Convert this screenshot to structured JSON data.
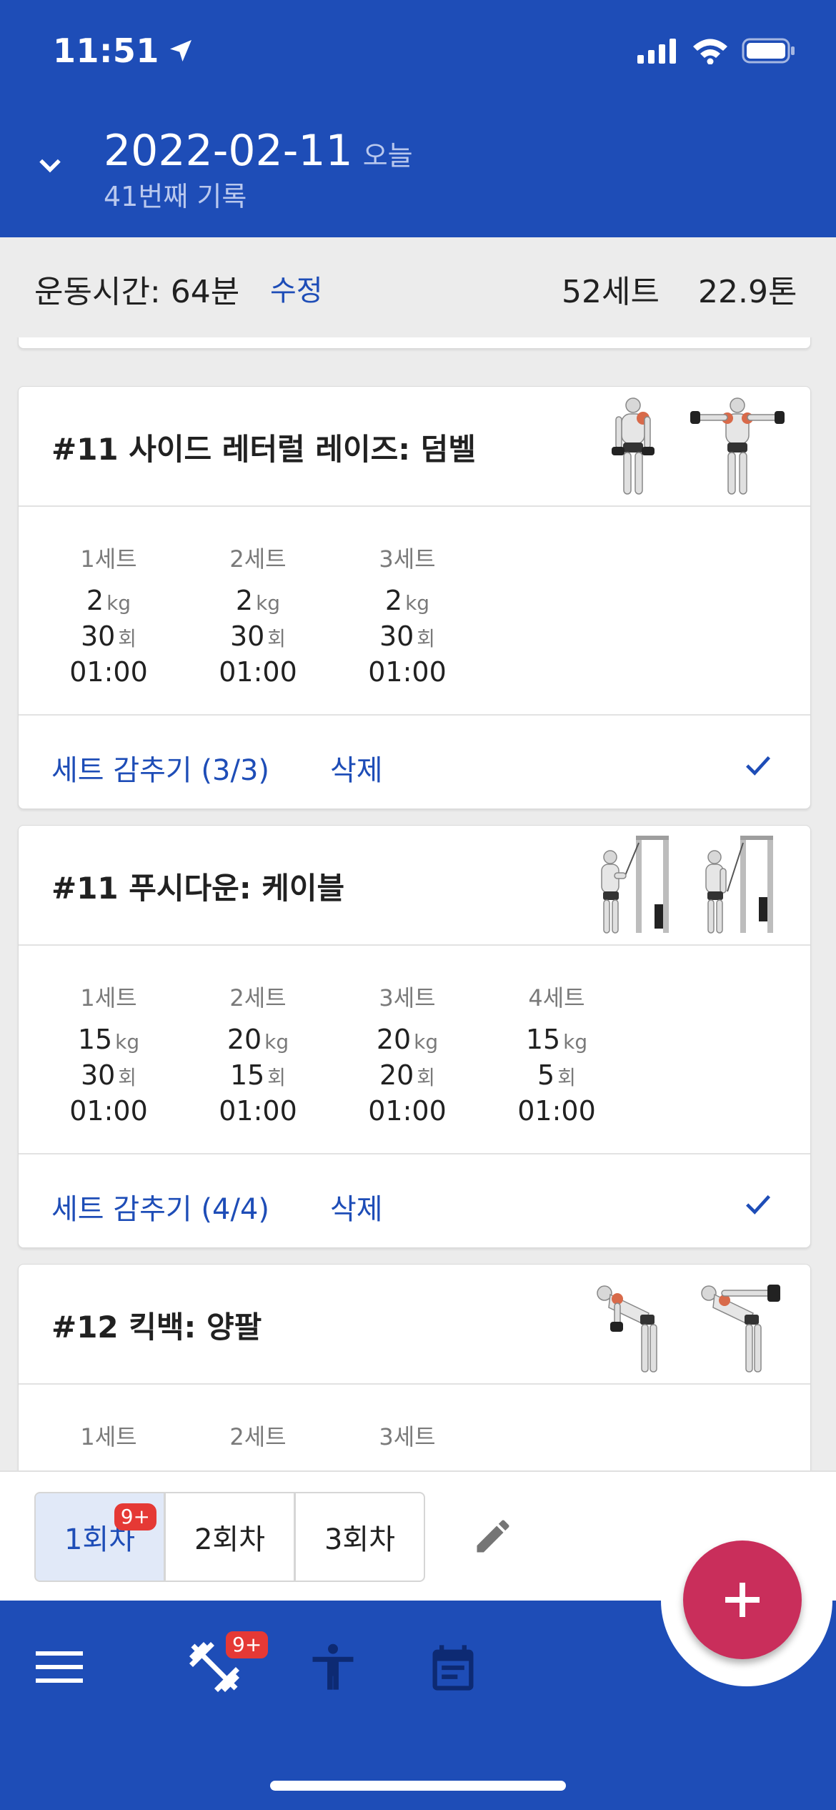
{
  "status": {
    "time": "11:51"
  },
  "header": {
    "date": "2022-02-11",
    "today_label": "오늘",
    "record_count": "41번째 기록"
  },
  "summary": {
    "duration": "운동시간: 64분",
    "edit_label": "수정",
    "sets_total": "52세트",
    "volume_total": "22.9톤"
  },
  "exercises": [
    {
      "title": "#11 사이드 레터럴 레이즈: 덤벨",
      "sets": [
        {
          "name": "1세트",
          "weight": "2",
          "weight_unit": "kg",
          "reps": "30",
          "reps_unit": "회",
          "time": "01:00"
        },
        {
          "name": "2세트",
          "weight": "2",
          "weight_unit": "kg",
          "reps": "30",
          "reps_unit": "회",
          "time": "01:00"
        },
        {
          "name": "3세트",
          "weight": "2",
          "weight_unit": "kg",
          "reps": "30",
          "reps_unit": "회",
          "time": "01:00"
        }
      ],
      "hide_label": "세트 감추기 (3/3)",
      "delete_label": "삭제"
    },
    {
      "title": "#11 푸시다운: 케이블",
      "sets": [
        {
          "name": "1세트",
          "weight": "15",
          "weight_unit": "kg",
          "reps": "30",
          "reps_unit": "회",
          "time": "01:00"
        },
        {
          "name": "2세트",
          "weight": "20",
          "weight_unit": "kg",
          "reps": "15",
          "reps_unit": "회",
          "time": "01:00"
        },
        {
          "name": "3세트",
          "weight": "20",
          "weight_unit": "kg",
          "reps": "20",
          "reps_unit": "회",
          "time": "01:00"
        },
        {
          "name": "4세트",
          "weight": "15",
          "weight_unit": "kg",
          "reps": "5",
          "reps_unit": "회",
          "time": "01:00"
        }
      ],
      "hide_label": "세트 감추기 (4/4)",
      "delete_label": "삭제"
    },
    {
      "title": "#12 킥백: 양팔",
      "sets": [
        {
          "name": "1세트"
        },
        {
          "name": "2세트"
        },
        {
          "name": "3세트"
        }
      ]
    }
  ],
  "sessions": [
    {
      "label": "1회차",
      "badge": "9+"
    },
    {
      "label": "2회차"
    },
    {
      "label": "3회차"
    }
  ],
  "nav": {
    "workout_badge": "9+"
  },
  "colors": {
    "primary": "#1e4db7",
    "fab": "#c92e5b",
    "badge": "#e53935",
    "active_segment": "#e1e9f8"
  }
}
